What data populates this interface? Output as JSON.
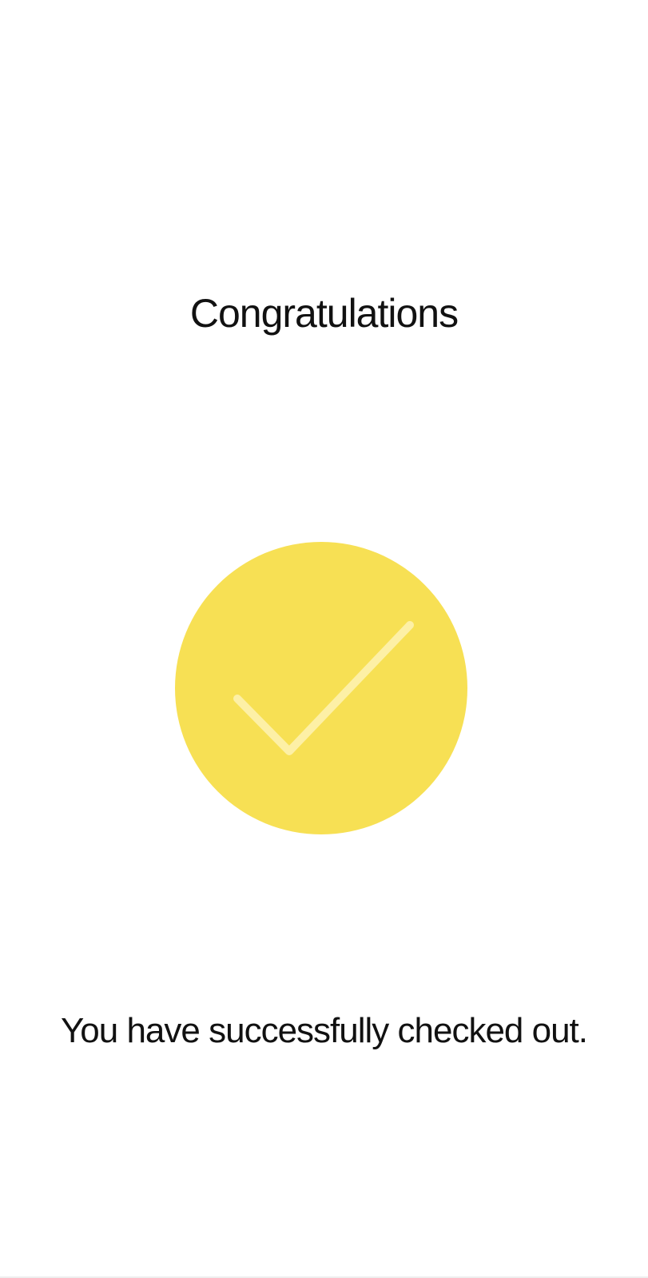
{
  "screen": {
    "title": "Congratulations",
    "message": "You have successfully checked out.",
    "status_icon": "checkmark-icon"
  },
  "colors": {
    "background": "#ffffff",
    "text": "#111111",
    "accent_circle": "#f7e054",
    "checkmark": "#fdf0a6"
  }
}
